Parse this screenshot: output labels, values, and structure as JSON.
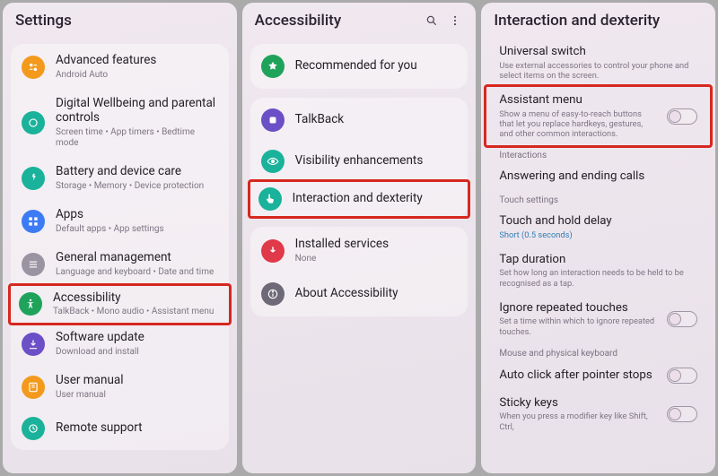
{
  "panel1": {
    "title": "Settings",
    "items": [
      {
        "icon": "advanced-icon",
        "iconColor": "c-orange",
        "title": "Advanced features",
        "sub": "Android Auto"
      },
      {
        "icon": "wellbeing-icon",
        "iconColor": "c-teal",
        "title": "Digital Wellbeing and parental controls",
        "sub": "Screen time • App timers • Bedtime mode"
      },
      {
        "icon": "battery-icon",
        "iconColor": "c-teal",
        "title": "Battery and device care",
        "sub": "Storage • Memory • Device protection"
      },
      {
        "icon": "apps-icon",
        "iconColor": "c-blue",
        "title": "Apps",
        "sub": "Default apps • App settings"
      },
      {
        "icon": "general-icon",
        "iconColor": "c-grey",
        "title": "General management",
        "sub": "Language and keyboard • Date and time"
      },
      {
        "icon": "accessibility-icon",
        "iconColor": "c-green",
        "title": "Accessibility",
        "sub": "TalkBack • Mono audio • Assistant menu",
        "highlighted": true
      },
      {
        "icon": "update-icon",
        "iconColor": "c-purple",
        "title": "Software update",
        "sub": "Download and install"
      },
      {
        "icon": "manual-icon",
        "iconColor": "c-orange",
        "title": "User manual",
        "sub": "User manual"
      },
      {
        "icon": "remote-icon",
        "iconColor": "c-teal",
        "title": "Remote support",
        "sub": ""
      }
    ]
  },
  "panel2": {
    "title": "Accessibility",
    "items": [
      {
        "icon": "star-icon",
        "iconColor": "c-green",
        "title": "Recommended for you"
      },
      {
        "icon": "talkback-icon",
        "iconColor": "c-purple",
        "title": "TalkBack"
      },
      {
        "icon": "visibility-icon",
        "iconColor": "c-teal",
        "title": "Visibility enhancements"
      },
      {
        "icon": "interaction-icon",
        "iconColor": "c-teal",
        "title": "Interaction and dexterity",
        "highlighted": true
      },
      {
        "icon": "installed-icon",
        "iconColor": "c-red",
        "title": "Installed services",
        "sub": "None"
      },
      {
        "icon": "about-icon",
        "iconColor": "c-darkgrey",
        "title": "About Accessibility"
      }
    ]
  },
  "panel3": {
    "title": "Interaction and dexterity",
    "groups": [
      {
        "label": null,
        "items": [
          {
            "title": "Universal switch",
            "sub": "Use external accessories to control your phone and select items on the screen."
          },
          {
            "title": "Assistant menu",
            "sub": "Show a menu of easy-to-reach buttons that let you replace hardkeys, gestures, and other common interactions.",
            "toggle": true,
            "highlighted": true
          }
        ]
      },
      {
        "label": "Interactions",
        "items": [
          {
            "title": "Answering and ending calls"
          }
        ]
      },
      {
        "label": "Touch settings",
        "items": [
          {
            "title": "Touch and hold delay",
            "sub": "Short (0.5 seconds)",
            "subColor": "#2f7fb8"
          },
          {
            "title": "Tap duration",
            "sub": "Set how long an interaction needs to be held to be recognised as a tap."
          },
          {
            "title": "Ignore repeated touches",
            "sub": "Set a time within which to ignore repeated touches.",
            "toggle": true
          }
        ]
      },
      {
        "label": "Mouse and physical keyboard",
        "items": [
          {
            "title": "Auto click after pointer stops",
            "toggle": true
          },
          {
            "title": "Sticky keys",
            "sub": "When you press a modifier key like Shift, Ctrl,",
            "toggle": true
          }
        ]
      }
    ]
  }
}
